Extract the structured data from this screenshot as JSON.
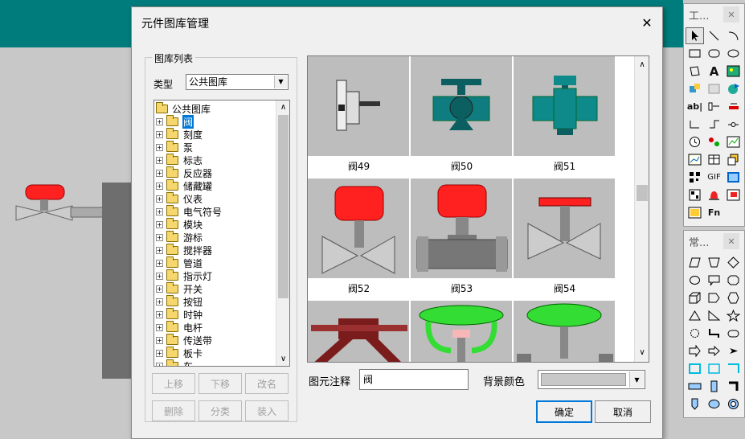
{
  "dialog": {
    "title": "元件图库管理",
    "close_glyph": "✕"
  },
  "library_group": {
    "legend": "图库列表",
    "type_label": "类型",
    "type_value": "公共图库",
    "root_label": "公共图库",
    "tree_items": [
      "阀",
      "刻度",
      "泵",
      "标志",
      "反应器",
      "储藏罐",
      "仪表",
      "电气符号",
      "模块",
      "游标",
      "搅拌器",
      "管道",
      "指示灯",
      "开关",
      "按钮",
      "时钟",
      "电杆",
      "传送带",
      "板卡",
      "车"
    ],
    "selected_index": 0,
    "buttons": [
      "上移",
      "下移",
      "改名",
      "删除",
      "分类",
      "装入"
    ]
  },
  "preview": {
    "captions": [
      "阀49",
      "阀50",
      "阀51",
      "阀52",
      "阀53",
      "阀54"
    ]
  },
  "note": {
    "label": "图元注释",
    "value": "阀"
  },
  "background": {
    "label": "背景颜色",
    "color": "#c8c8c8"
  },
  "actions": {
    "ok": "确定",
    "cancel": "取消"
  },
  "palettes": {
    "tools_title": "工...",
    "common_title": "常...",
    "close_glyph": "✕",
    "tool_text_labels": [
      "ab|",
      "GIF",
      "Fn",
      "A"
    ]
  },
  "colors": {
    "teal": "#007c7c",
    "valve_red": "#ff2020",
    "valve_green": "#33dd33",
    "dark_teal": "#0b5f61"
  }
}
